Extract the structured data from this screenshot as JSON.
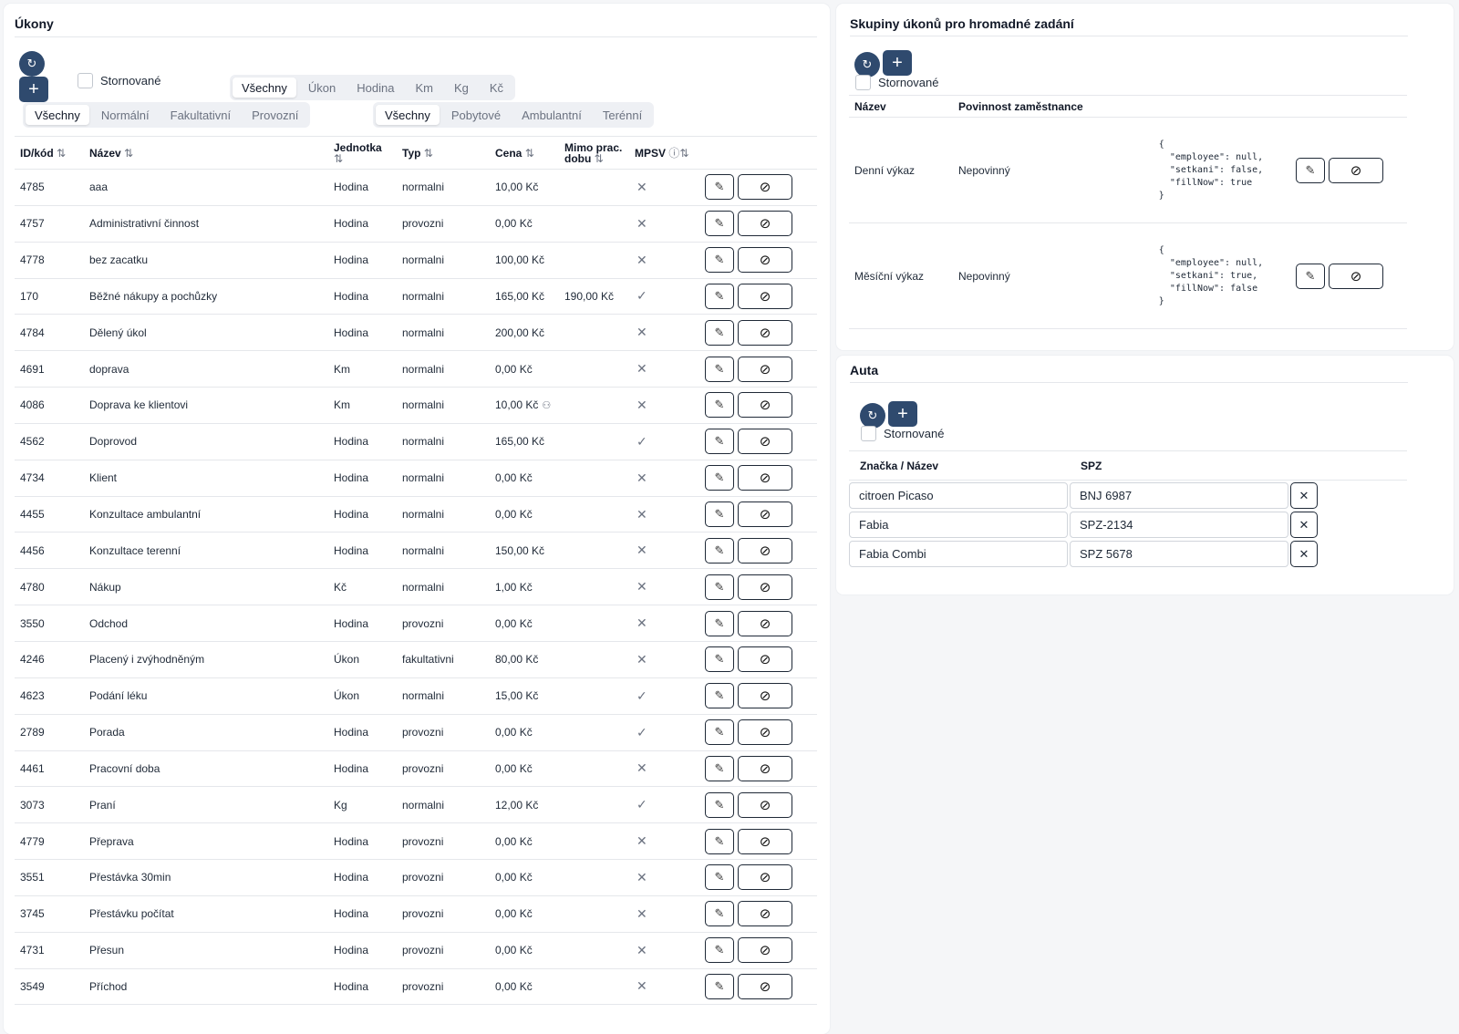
{
  "ukony": {
    "title": "Úkony",
    "refresh_icon": "refresh-icon",
    "add_icon": "plus-icon",
    "stornovane_label": "Stornované",
    "unit_filter": [
      "Všechny",
      "Úkon",
      "Hodina",
      "Km",
      "Kg",
      "Kč"
    ],
    "unit_filter_active": 0,
    "type_filter": [
      "Všechny",
      "Normální",
      "Fakultativní",
      "Provozní"
    ],
    "type_filter_active": 0,
    "service_filter": [
      "Všechny",
      "Pobytové",
      "Ambulantní",
      "Terénní"
    ],
    "service_filter_active": 0,
    "columns": {
      "id": "ID/kód",
      "name": "Název",
      "unit_line1": "Jednotka",
      "type": "Typ",
      "price": "Cena",
      "outside_line1": "Mimo prac.",
      "outside_line2": "dobu",
      "mpsv": "MPSV"
    },
    "sort_icon": "⇅",
    "rows": [
      {
        "id": "4785",
        "name": "aaa",
        "unit": "Hodina",
        "type": "normalni",
        "price": "10,00 Kč",
        "outside": "",
        "mpsv": "✕"
      },
      {
        "id": "4757",
        "name": "Administrativní činnost",
        "unit": "Hodina",
        "type": "provozni",
        "price": "0,00 Kč",
        "outside": "",
        "mpsv": "✕"
      },
      {
        "id": "4778",
        "name": "bez zacatku",
        "unit": "Hodina",
        "type": "normalni",
        "price": "100,00 Kč",
        "outside": "",
        "mpsv": "✕"
      },
      {
        "id": "170",
        "name": "Běžné nákupy a pochůzky",
        "unit": "Hodina",
        "type": "normalni",
        "price": "165,00 Kč",
        "outside": "190,00 Kč",
        "mpsv": "✓"
      },
      {
        "id": "4784",
        "name": "Dělený úkol",
        "unit": "Hodina",
        "type": "normalni",
        "price": "200,00 Kč",
        "outside": "",
        "mpsv": "✕"
      },
      {
        "id": "4691",
        "name": "doprava",
        "unit": "Km",
        "type": "normalni",
        "price": "0,00 Kč",
        "outside": "",
        "mpsv": "✕"
      },
      {
        "id": "4086",
        "name": "Doprava ke klientovi",
        "unit": "Km",
        "type": "normalni",
        "price": "10,00 Kč",
        "outside": "",
        "mpsv": "✕",
        "people_icon": true
      },
      {
        "id": "4562",
        "name": "Doprovod",
        "unit": "Hodina",
        "type": "normalni",
        "price": "165,00 Kč",
        "outside": "",
        "mpsv": "✓"
      },
      {
        "id": "4734",
        "name": "Klient",
        "unit": "Hodina",
        "type": "normalni",
        "price": "0,00 Kč",
        "outside": "",
        "mpsv": "✕"
      },
      {
        "id": "4455",
        "name": "Konzultace ambulantní",
        "unit": "Hodina",
        "type": "normalni",
        "price": "0,00 Kč",
        "outside": "",
        "mpsv": "✕"
      },
      {
        "id": "4456",
        "name": "Konzultace terenní",
        "unit": "Hodina",
        "type": "normalni",
        "price": "150,00 Kč",
        "outside": "",
        "mpsv": "✕"
      },
      {
        "id": "4780",
        "name": "Nákup",
        "unit": "Kč",
        "type": "normalni",
        "price": "1,00 Kč",
        "outside": "",
        "mpsv": "✕"
      },
      {
        "id": "3550",
        "name": "Odchod",
        "unit": "Hodina",
        "type": "provozni",
        "price": "0,00 Kč",
        "outside": "",
        "mpsv": "✕"
      },
      {
        "id": "4246",
        "name": "Placený i zvýhodněným",
        "unit": "Úkon",
        "type": "fakultativni",
        "price": "80,00 Kč",
        "outside": "",
        "mpsv": "✕"
      },
      {
        "id": "4623",
        "name": "Podání léku",
        "unit": "Úkon",
        "type": "normalni",
        "price": "15,00 Kč",
        "outside": "",
        "mpsv": "✓"
      },
      {
        "id": "2789",
        "name": "Porada",
        "unit": "Hodina",
        "type": "provozni",
        "price": "0,00 Kč",
        "outside": "",
        "mpsv": "✓"
      },
      {
        "id": "4461",
        "name": "Pracovní doba",
        "unit": "Hodina",
        "type": "provozni",
        "price": "0,00 Kč",
        "outside": "",
        "mpsv": "✕"
      },
      {
        "id": "3073",
        "name": "Praní",
        "unit": "Kg",
        "type": "normalni",
        "price": "12,00 Kč",
        "outside": "",
        "mpsv": "✓"
      },
      {
        "id": "4779",
        "name": "Přeprava",
        "unit": "Hodina",
        "type": "provozni",
        "price": "0,00 Kč",
        "outside": "",
        "mpsv": "✕"
      },
      {
        "id": "3551",
        "name": "Přestávka 30min",
        "unit": "Hodina",
        "type": "provozni",
        "price": "0,00 Kč",
        "outside": "",
        "mpsv": "✕"
      },
      {
        "id": "3745",
        "name": "Přestávku počítat",
        "unit": "Hodina",
        "type": "provozni",
        "price": "0,00 Kč",
        "outside": "",
        "mpsv": "✕"
      },
      {
        "id": "4731",
        "name": "Přesun",
        "unit": "Hodina",
        "type": "provozni",
        "price": "0,00 Kč",
        "outside": "",
        "mpsv": "✕"
      },
      {
        "id": "3549",
        "name": "Příchod",
        "unit": "Hodina",
        "type": "provozni",
        "price": "0,00 Kč",
        "outside": "",
        "mpsv": "✕"
      }
    ]
  },
  "skupiny": {
    "title": "Skupiny úkonů pro hromadné zadání",
    "stornovane_label": "Stornované",
    "columns": {
      "name": "Název",
      "duty": "Povinnost zaměstnance"
    },
    "rows": [
      {
        "name": "Denní výkaz",
        "duty": "Nepovinný",
        "json": "{\n  \"employee\": null,\n  \"setkani\": false,\n  \"fillNow\": true\n}"
      },
      {
        "name": "Měsíční výkaz",
        "duty": "Nepovinný",
        "json": "{\n  \"employee\": null,\n  \"setkani\": true,\n  \"fillNow\": false\n}"
      }
    ]
  },
  "auta": {
    "title": "Auta",
    "stornovane_label": "Stornované",
    "columns": {
      "name": "Značka / Název",
      "spz": "SPZ"
    },
    "rows": [
      {
        "name": "citroen Picaso",
        "spz": "BNJ 6987"
      },
      {
        "name": "Fabia",
        "spz": "SPZ-2134"
      },
      {
        "name": "Fabia Combi",
        "spz": "SPZ 5678"
      }
    ]
  },
  "icons": {
    "refresh": "↻",
    "plus": "+",
    "edit": "✎",
    "cancel": "⊘",
    "close": "✕",
    "info": "ⓘ",
    "people": "⚇"
  },
  "colors": {
    "primary_button": "#2f4a6e",
    "segment_bg": "#eef0f4"
  }
}
